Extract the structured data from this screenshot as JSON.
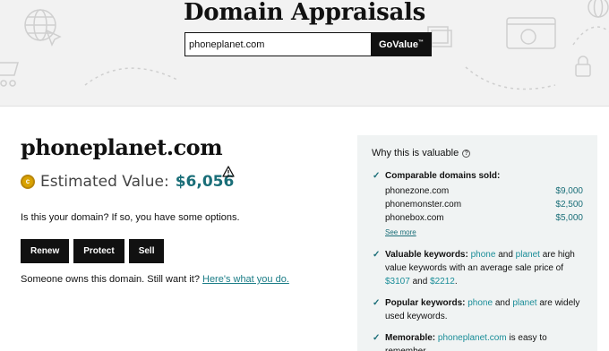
{
  "hero": {
    "title": "Domain Appraisals",
    "search_value": "phoneplanet.com",
    "button_label": "GoValue",
    "button_tm": "™"
  },
  "result": {
    "domain": "phoneplanet.com",
    "estimated_label": "Estimated Value:",
    "estimated_value": "$6,056",
    "question": "Is this your domain? If so, you have some options.",
    "buttons": [
      "Renew",
      "Protect",
      "Sell"
    ],
    "owned_text": "Someone owns this domain. Still want it?",
    "owned_link": "Here's what you do."
  },
  "panel": {
    "title": "Why this is valuable",
    "comparable_title": "Comparable domains sold:",
    "comparables": [
      {
        "domain": "phonezone.com",
        "price": "$9,000"
      },
      {
        "domain": "phonemonster.com",
        "price": "$2,500"
      },
      {
        "domain": "phonebox.com",
        "price": "$5,000"
      }
    ],
    "see_more": "See more",
    "valuable": {
      "label": "Valuable keywords:",
      "kw1": "phone",
      "and1": "and",
      "kw2": "planet",
      "text1": "are high value keywords with an average sale price of",
      "price1": "$3107",
      "and2": "and",
      "price2": "$2212",
      "end": "."
    },
    "popular": {
      "label": "Popular keywords:",
      "kw1": "phone",
      "and1": "and",
      "kw2": "planet",
      "text1": "are widely used keywords."
    },
    "memorable": {
      "label": "Memorable:",
      "domain": "phoneplanet.com",
      "text1": "is easy to remember."
    }
  },
  "colors": {
    "accent": "#1a6e78",
    "link": "#1a8d98",
    "hero_bg": "#f2f2f2",
    "panel_bg": "#f0f3f3",
    "button_bg": "#111111",
    "coin": "#d9a200"
  }
}
